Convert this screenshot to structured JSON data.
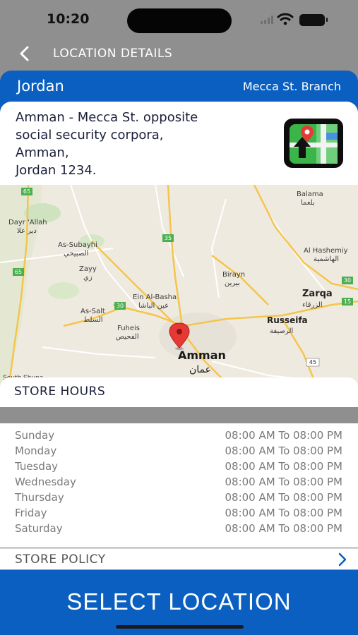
{
  "status_bar": {
    "time": "10:20"
  },
  "nav": {
    "title": "LOCATION DETAILS"
  },
  "header": {
    "country": "Jordan",
    "branch": "Mecca St. Branch"
  },
  "address": {
    "lines": [
      "Amman - Mecca St. opposite",
      "social security corpora,",
      "Amman,",
      "Jordan 1234."
    ]
  },
  "map": {
    "labels": {
      "balama": "Balama",
      "balama_ar": "بلعما",
      "dayr_allah": "Dayr 'Allah",
      "dayr_allah_ar": "دير علا",
      "as_subayhi": "As-Subayhi",
      "as_subayhi_ar": "الصبيحي",
      "zayy": "Zayy",
      "zayy_ar": "زي",
      "al_hashemiya": "Al Hashemiy",
      "al_hashemiya_ar": "الهاشمية",
      "birayn": "Birayn",
      "birayn_ar": "بيرين",
      "zarqa": "Zarqa",
      "zarqa_ar": "الزرقاء",
      "ein_al_basha": "Ein Al-Basha",
      "ein_al_basha_ar": "عين الباشا",
      "as_salt": "As-Salt",
      "as_salt_ar": "السلط",
      "russeifa": "Russeifa",
      "russeifa_ar": "الرصيفة",
      "fuheis": "Fuheis",
      "fuheis_ar": "الفحيص",
      "amman": "Amman",
      "amman_ar": "عمان",
      "south_shuna": "South Shuna"
    },
    "road_shields": {
      "r65a": "65",
      "r35": "35",
      "r65b": "65",
      "r30a": "30",
      "r30b": "30",
      "r15": "15",
      "r45": "45"
    }
  },
  "store_hours": {
    "title": "STORE HOURS",
    "rows": [
      {
        "day": "Sunday",
        "hours": "08:00 AM To 08:00 PM"
      },
      {
        "day": "Monday",
        "hours": "08:00 AM To 08:00 PM"
      },
      {
        "day": "Tuesday",
        "hours": "08:00 AM To 08:00 PM"
      },
      {
        "day": "Wednesday",
        "hours": "08:00 AM To 08:00 PM"
      },
      {
        "day": "Thursday",
        "hours": "08:00 AM To 08:00 PM"
      },
      {
        "day": "Friday",
        "hours": "08:00 AM To 08:00 PM"
      },
      {
        "day": "Saturday",
        "hours": "08:00 AM To 08:00 PM"
      }
    ]
  },
  "store_policy": {
    "label": "STORE POLICY"
  },
  "select_button": {
    "label": "SELECT LOCATION"
  },
  "colors": {
    "primary_blue": "#0a5fc1",
    "pin_red": "#e53935"
  },
  "icons": {
    "back": "chevron-left-icon",
    "maps_app": "maps-app-icon",
    "policy_arrow": "chevron-right-icon",
    "pin": "map-pin-icon"
  }
}
